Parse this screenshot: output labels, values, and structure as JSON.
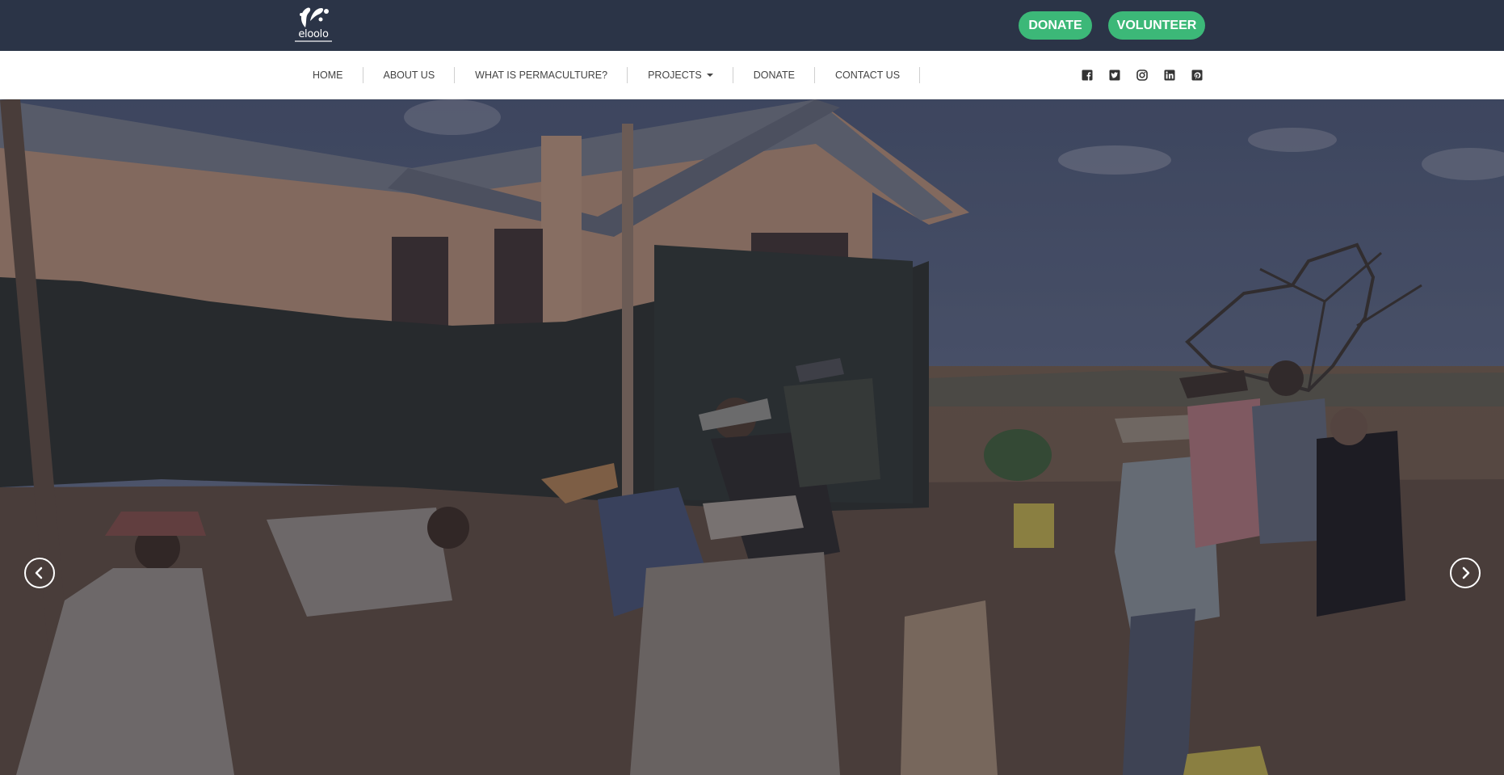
{
  "brand": {
    "name": "eloolo"
  },
  "header": {
    "donate_label": "DONATE",
    "volunteer_label": "VOLUNTEER"
  },
  "nav": {
    "items": [
      {
        "label": "HOME"
      },
      {
        "label": "ABOUT US"
      },
      {
        "label": "WHAT IS PERMACULTURE?"
      },
      {
        "label": "PROJECTS",
        "dropdown": true
      },
      {
        "label": "DONATE"
      },
      {
        "label": "CONTACT US"
      }
    ]
  },
  "social": [
    "facebook-icon",
    "twitter-icon",
    "instagram-icon",
    "linkedin-icon",
    "pinterest-icon"
  ],
  "carousel": {
    "prev_icon": "chevron-left-icon",
    "next_icon": "chevron-right-icon"
  },
  "colors": {
    "header_bg": "#2b3447",
    "accent_green": "#3cb878",
    "nav_bg": "#ffffff",
    "nav_text": "#444444"
  }
}
